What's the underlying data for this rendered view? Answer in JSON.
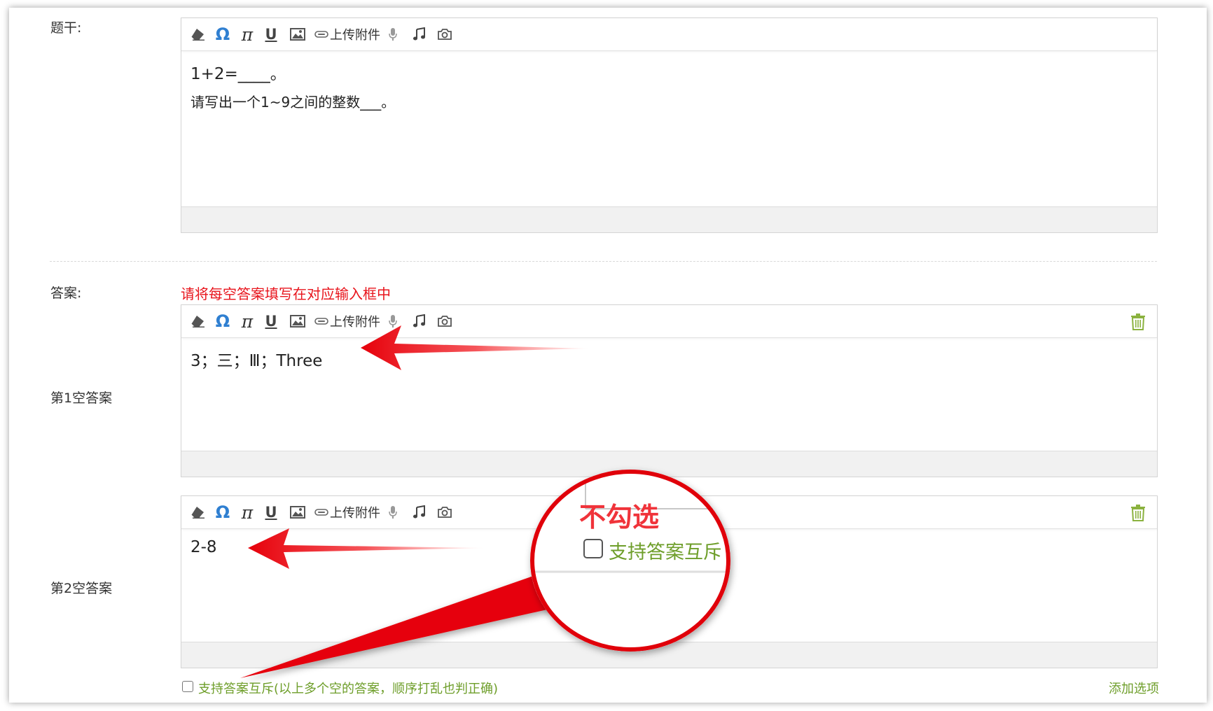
{
  "stem": {
    "label": "题干:",
    "line1": "1+2=____。",
    "line2": "请写出一个1~9之间的整数___。"
  },
  "toolbar": {
    "icons": [
      "eraser-icon",
      "omega-icon",
      "pi-icon",
      "underline-icon",
      "image-icon",
      "attachment-icon",
      "microphone-icon",
      "music-icon",
      "camera-icon"
    ],
    "upload_label": "上传附件"
  },
  "answer": {
    "label": "答案:",
    "hint": "请将每空答案填写在对应输入框中",
    "hint_color": "#e8141c",
    "blanks": [
      {
        "label": "第1空答案",
        "value": "3；三；Ⅲ；Three"
      },
      {
        "label": "第2空答案",
        "value": "2-8"
      }
    ]
  },
  "footer": {
    "mutex_label": "支持答案互斥",
    "mutex_note": "(以上多个空的答案，顺序打乱也判正确)",
    "mutex_checked": false,
    "add_option": "添加选项",
    "accent_color": "#6e9e2a"
  },
  "callout": {
    "text": "不勾选",
    "checkbox_label": "支持答案互斥"
  }
}
